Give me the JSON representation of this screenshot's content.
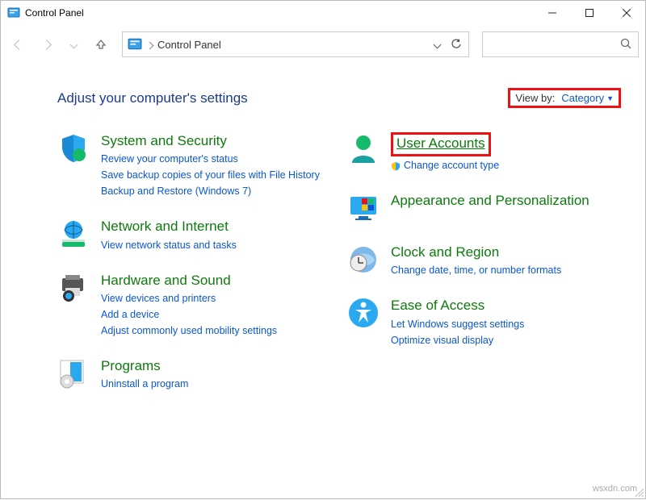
{
  "window": {
    "title": "Control Panel"
  },
  "address": {
    "text": "Control Panel"
  },
  "heading": "Adjust your computer's settings",
  "viewby": {
    "label": "View by:",
    "value": "Category"
  },
  "left_column": [
    {
      "title": "System and Security",
      "links": [
        "Review your computer's status",
        "Save backup copies of your files with File History",
        "Backup and Restore (Windows 7)"
      ]
    },
    {
      "title": "Network and Internet",
      "links": [
        "View network status and tasks"
      ]
    },
    {
      "title": "Hardware and Sound",
      "links": [
        "View devices and printers",
        "Add a device",
        "Adjust commonly used mobility settings"
      ]
    },
    {
      "title": "Programs",
      "links": [
        "Uninstall a program"
      ]
    }
  ],
  "right_column": [
    {
      "title": "User Accounts",
      "links": [
        "Change account type"
      ],
      "shield": true,
      "highlighted": true
    },
    {
      "title": "Appearance and Personalization",
      "links": []
    },
    {
      "title": "Clock and Region",
      "links": [
        "Change date, time, or number formats"
      ]
    },
    {
      "title": "Ease of Access",
      "links": [
        "Let Windows suggest settings",
        "Optimize visual display"
      ]
    }
  ],
  "watermark": "wsxdn.com"
}
